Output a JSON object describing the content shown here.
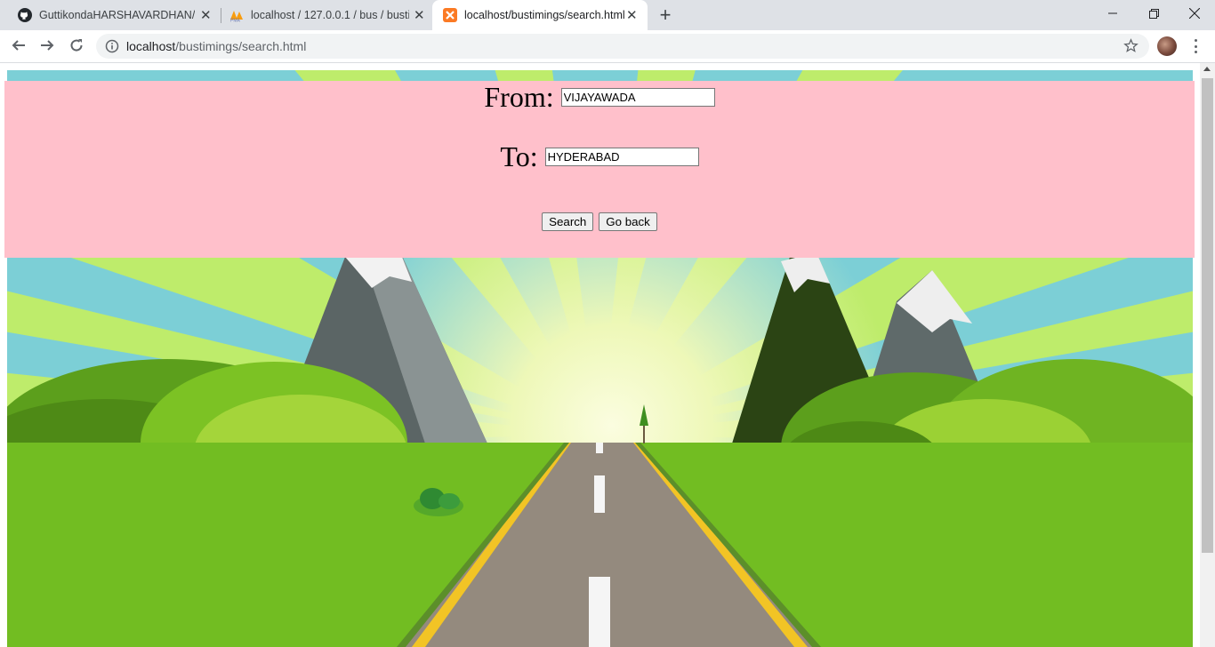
{
  "browser": {
    "tabs": [
      {
        "title": "GuttikondaHARSHAVARDHAN/gu",
        "icon": "github-icon",
        "active": false
      },
      {
        "title": "localhost / 127.0.0.1 / bus / busti",
        "icon": "phpmyadmin-icon",
        "active": false
      },
      {
        "title": "localhost/bustimings/search.html",
        "icon": "xampp-icon",
        "active": true
      }
    ],
    "url_host": "localhost",
    "url_path": "/bustimings/search.html"
  },
  "form": {
    "from_label": "From:",
    "from_value": "VIJAYAWADA",
    "to_label": "To:",
    "to_value": "HYDERABAD",
    "search_label": "Search",
    "back_label": "Go back"
  },
  "colors": {
    "panel_bg": "#ffc0cb",
    "sky": "#7ccfd6",
    "grass": "#72bd22",
    "road": "#948a7e",
    "road_edge": "#f2c425"
  }
}
